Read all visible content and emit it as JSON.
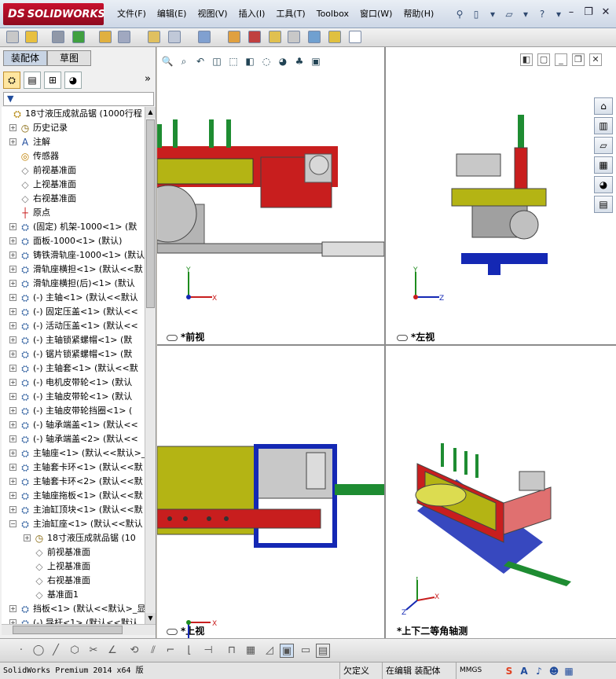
{
  "app": {
    "logo_ds": "DS",
    "logo_text": "SOLIDWORKS"
  },
  "menu": [
    "文件(F)",
    "编辑(E)",
    "视图(V)",
    "插入(I)",
    "工具(T)",
    "Toolbox",
    "窗口(W)",
    "帮助(H)"
  ],
  "title_tools": {
    "help": "?"
  },
  "panel": {
    "tabs": [
      "装配体",
      "草图"
    ],
    "expand": "»",
    "filter_icon": "▼"
  },
  "tree": [
    {
      "label": "18寸液压成就品锯 (1000行程",
      "icon": "assembly-icon",
      "level": 0,
      "exp": "none"
    },
    {
      "label": "历史记录",
      "icon": "history-icon",
      "level": 1,
      "exp": "plus"
    },
    {
      "label": "注解",
      "icon": "annotation-icon",
      "level": 1,
      "exp": "plus"
    },
    {
      "label": "传感器",
      "icon": "sensor-icon",
      "level": 1,
      "exp": "none"
    },
    {
      "label": "前视基准面",
      "icon": "plane-icon",
      "level": 1,
      "exp": "none"
    },
    {
      "label": "上视基准面",
      "icon": "plane-icon",
      "level": 1,
      "exp": "none"
    },
    {
      "label": "右视基准面",
      "icon": "plane-icon",
      "level": 1,
      "exp": "none"
    },
    {
      "label": "原点",
      "icon": "origin-icon",
      "level": 1,
      "exp": "none"
    },
    {
      "label": "(固定) 机架-1000<1> (默",
      "icon": "part-icon",
      "level": 1,
      "exp": "plus"
    },
    {
      "label": "面板-1000<1> (默认)",
      "icon": "part-icon",
      "level": 1,
      "exp": "plus"
    },
    {
      "label": "铸铁滑轨座-1000<1> (默认",
      "icon": "part-icon",
      "level": 1,
      "exp": "plus"
    },
    {
      "label": "滑轨座横担<1> (默认<<默",
      "icon": "part-icon",
      "level": 1,
      "exp": "plus"
    },
    {
      "label": "滑轨座横担(后)<1> (默认",
      "icon": "part-icon",
      "level": 1,
      "exp": "plus"
    },
    {
      "label": "(-) 主轴<1> (默认<<默认",
      "icon": "part-icon",
      "level": 1,
      "exp": "plus"
    },
    {
      "label": "(-) 固定压盖<1> (默认<<",
      "icon": "part-icon",
      "level": 1,
      "exp": "plus"
    },
    {
      "label": "(-) 活动压盖<1> (默认<<",
      "icon": "part-icon",
      "level": 1,
      "exp": "plus"
    },
    {
      "label": "(-) 主轴锁紧螺帽<1> (默",
      "icon": "part-icon",
      "level": 1,
      "exp": "plus"
    },
    {
      "label": "(-) 锯片锁紧螺帽<1> (默",
      "icon": "part-icon",
      "level": 1,
      "exp": "plus"
    },
    {
      "label": "(-) 主轴套<1> (默认<<默",
      "icon": "part-icon",
      "level": 1,
      "exp": "plus"
    },
    {
      "label": "(-) 电机皮带轮<1> (默认",
      "icon": "part-icon",
      "level": 1,
      "exp": "plus"
    },
    {
      "label": "(-) 主轴皮带轮<1> (默认",
      "icon": "part-icon",
      "level": 1,
      "exp": "plus"
    },
    {
      "label": "(-) 主轴皮带轮挡圈<1> (",
      "icon": "part-icon",
      "level": 1,
      "exp": "plus"
    },
    {
      "label": "(-) 轴承端盖<1> (默认<<",
      "icon": "part-icon",
      "level": 1,
      "exp": "plus"
    },
    {
      "label": "(-) 轴承端盖<2> (默认<<",
      "icon": "part-icon",
      "level": 1,
      "exp": "plus"
    },
    {
      "label": "主轴座<1> (默认<<默认>_",
      "icon": "part-icon",
      "level": 1,
      "exp": "plus"
    },
    {
      "label": "主轴套卡环<1> (默认<<默",
      "icon": "part-icon",
      "level": 1,
      "exp": "plus"
    },
    {
      "label": "主轴套卡环<2> (默认<<默",
      "icon": "part-icon",
      "level": 1,
      "exp": "plus"
    },
    {
      "label": "主轴座拖板<1> (默认<<默",
      "icon": "part-icon",
      "level": 1,
      "exp": "plus"
    },
    {
      "label": "主油缸顶块<1> (默认<<默",
      "icon": "part-icon",
      "level": 1,
      "exp": "plus"
    },
    {
      "label": "主油缸座<1> (默认<<默认",
      "icon": "part-icon",
      "level": 1,
      "exp": "minus"
    },
    {
      "label": "18寸液压成就品锯 (10",
      "icon": "history-icon",
      "level": 2,
      "exp": "plus"
    },
    {
      "label": "前视基准面",
      "icon": "plane-icon",
      "level": 2,
      "exp": "none"
    },
    {
      "label": "上视基准面",
      "icon": "plane-icon",
      "level": 2,
      "exp": "none"
    },
    {
      "label": "右视基准面",
      "icon": "plane-icon",
      "level": 2,
      "exp": "none"
    },
    {
      "label": "基准面1",
      "icon": "plane-icon",
      "level": 2,
      "exp": "none"
    },
    {
      "label": "挡板<1> (默认<<默认>_显",
      "icon": "part-icon",
      "level": 1,
      "exp": "plus"
    },
    {
      "label": "(-) 导杆<1> (默认<<默认",
      "icon": "part-icon",
      "level": 1,
      "exp": "plus"
    }
  ],
  "viewports": {
    "front": "*前视",
    "left": "*左视",
    "top": "*上视",
    "iso": "*上下二等角轴测"
  },
  "triad": {
    "x": "X",
    "y": "Y",
    "z": "Z"
  },
  "status": {
    "app": "SolidWorks Premium 2014 x64 版",
    "state": "欠定义",
    "mode": "在编辑 装配体",
    "units": "MMGS"
  },
  "ime": [
    "S",
    "A",
    "♪",
    "☻",
    "▦"
  ],
  "colors": {
    "frame_red": "#c81e1e",
    "guard_yellow": "#b4b414",
    "base_blue": "#1428b4",
    "rail_green": "#1e8c32",
    "metal_gray": "#b4b4b4"
  }
}
